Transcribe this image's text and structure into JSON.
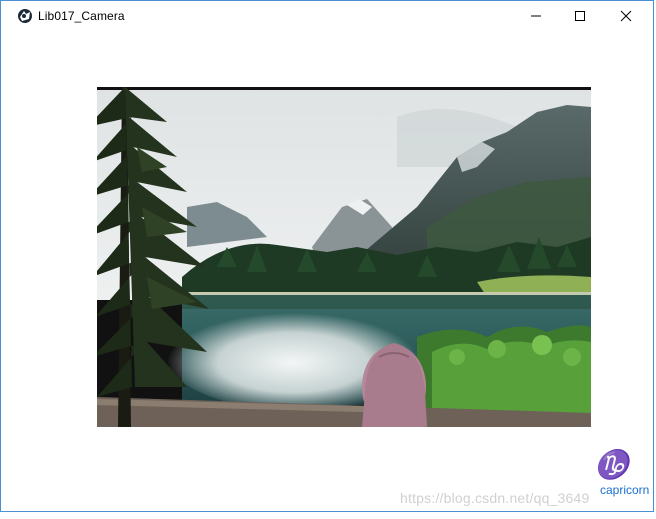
{
  "window": {
    "title": "Lib017_Camera",
    "controls": {
      "minimize_icon": "minimize-icon",
      "maximize_icon": "maximize-icon",
      "close_icon": "close-icon"
    }
  },
  "camera_view": {
    "scene": "mountain-lake-photo"
  },
  "watermark": {
    "text": "https://blog.csdn.net/qq_3649",
    "logo_text": "capricorn"
  },
  "colors": {
    "window_border": "#4a8ed6",
    "watermark": "#d0d0d0",
    "logo": "#1a6fd0"
  }
}
